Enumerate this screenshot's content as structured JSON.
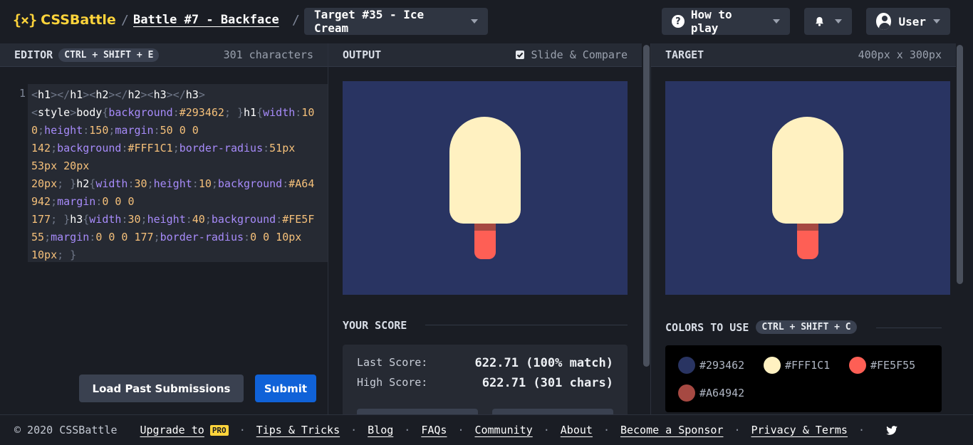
{
  "header": {
    "logo_mark": "{⨯}",
    "logo_text": "CSSBattle",
    "breadcrumb_sep": "/",
    "battle_title": "Battle #7 - Backface",
    "target_select": "Target #35 - Ice Cream",
    "how_to_play": "How to play",
    "user_label": "User"
  },
  "editor": {
    "title": "EDITOR",
    "shortcut": "CTRL + SHIFT + E",
    "char_count": "301 characters",
    "line_number": "1",
    "load_button": "Load Past Submissions",
    "submit_button": "Submit"
  },
  "output": {
    "title": "OUTPUT",
    "slide_compare": "Slide & Compare",
    "slide_compare_checked": true
  },
  "target": {
    "title": "TARGET",
    "size": "400px x 300px"
  },
  "score": {
    "title": "YOUR SCORE",
    "last_label": "Last Score:",
    "last_value": "622.71 (100% match)",
    "high_label": "High Score:",
    "high_value": "622.71 (301 chars)"
  },
  "colors": {
    "title": "COLORS TO USE",
    "shortcut": "CTRL + SHIFT + C",
    "items": [
      {
        "hex": "#293462",
        "label": "#293462"
      },
      {
        "hex": "#FFF1C1",
        "label": "#FFF1C1"
      },
      {
        "hex": "#FE5F55",
        "label": "#FE5F55"
      },
      {
        "hex": "#A64942",
        "label": "#A64942"
      }
    ]
  },
  "footer": {
    "copyright": "© 2020 CSSBattle",
    "upgrade": "Upgrade to",
    "pro_badge": "PRO",
    "tips": "Tips & Tricks",
    "blog": "Blog",
    "faqs": "FAQs",
    "community": "Community",
    "about": "About",
    "sponsor": "Become a Sponsor",
    "privacy": "Privacy & Terms",
    "sep": "·"
  }
}
